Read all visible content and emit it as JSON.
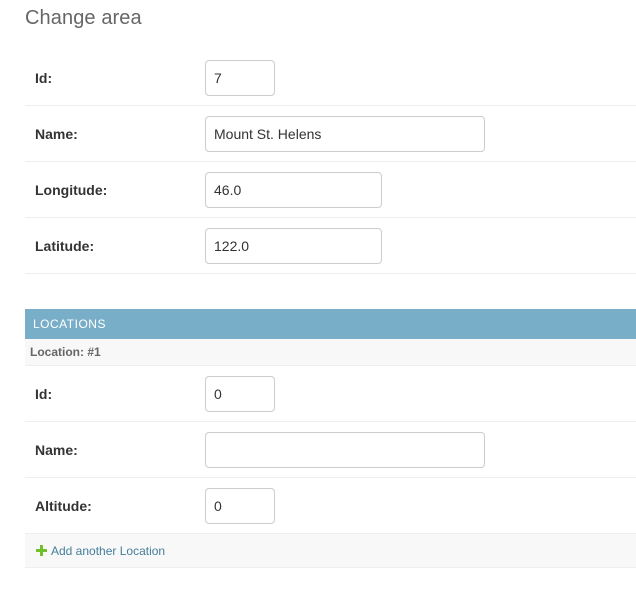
{
  "page": {
    "title": "Change area"
  },
  "area_form": {
    "fields": [
      {
        "label": "Id:",
        "value": "7"
      },
      {
        "label": "Name:",
        "value": "Mount St. Helens"
      },
      {
        "label": "Longitude:",
        "value": "46.0"
      },
      {
        "label": "Latitude:",
        "value": "122.0"
      }
    ]
  },
  "locations": {
    "header": "LOCATIONS",
    "subheader": "Location: #1",
    "fields": [
      {
        "label": "Id:",
        "value": "0"
      },
      {
        "label": "Name:",
        "value": ""
      },
      {
        "label": "Altitude:",
        "value": "0"
      }
    ],
    "add_label": "Add another Location"
  },
  "colors": {
    "inline_header_bg": "#79aec8",
    "link": "#447e9b",
    "add_icon": "#70bf2b"
  },
  "icons": {
    "add": "plus-icon"
  }
}
